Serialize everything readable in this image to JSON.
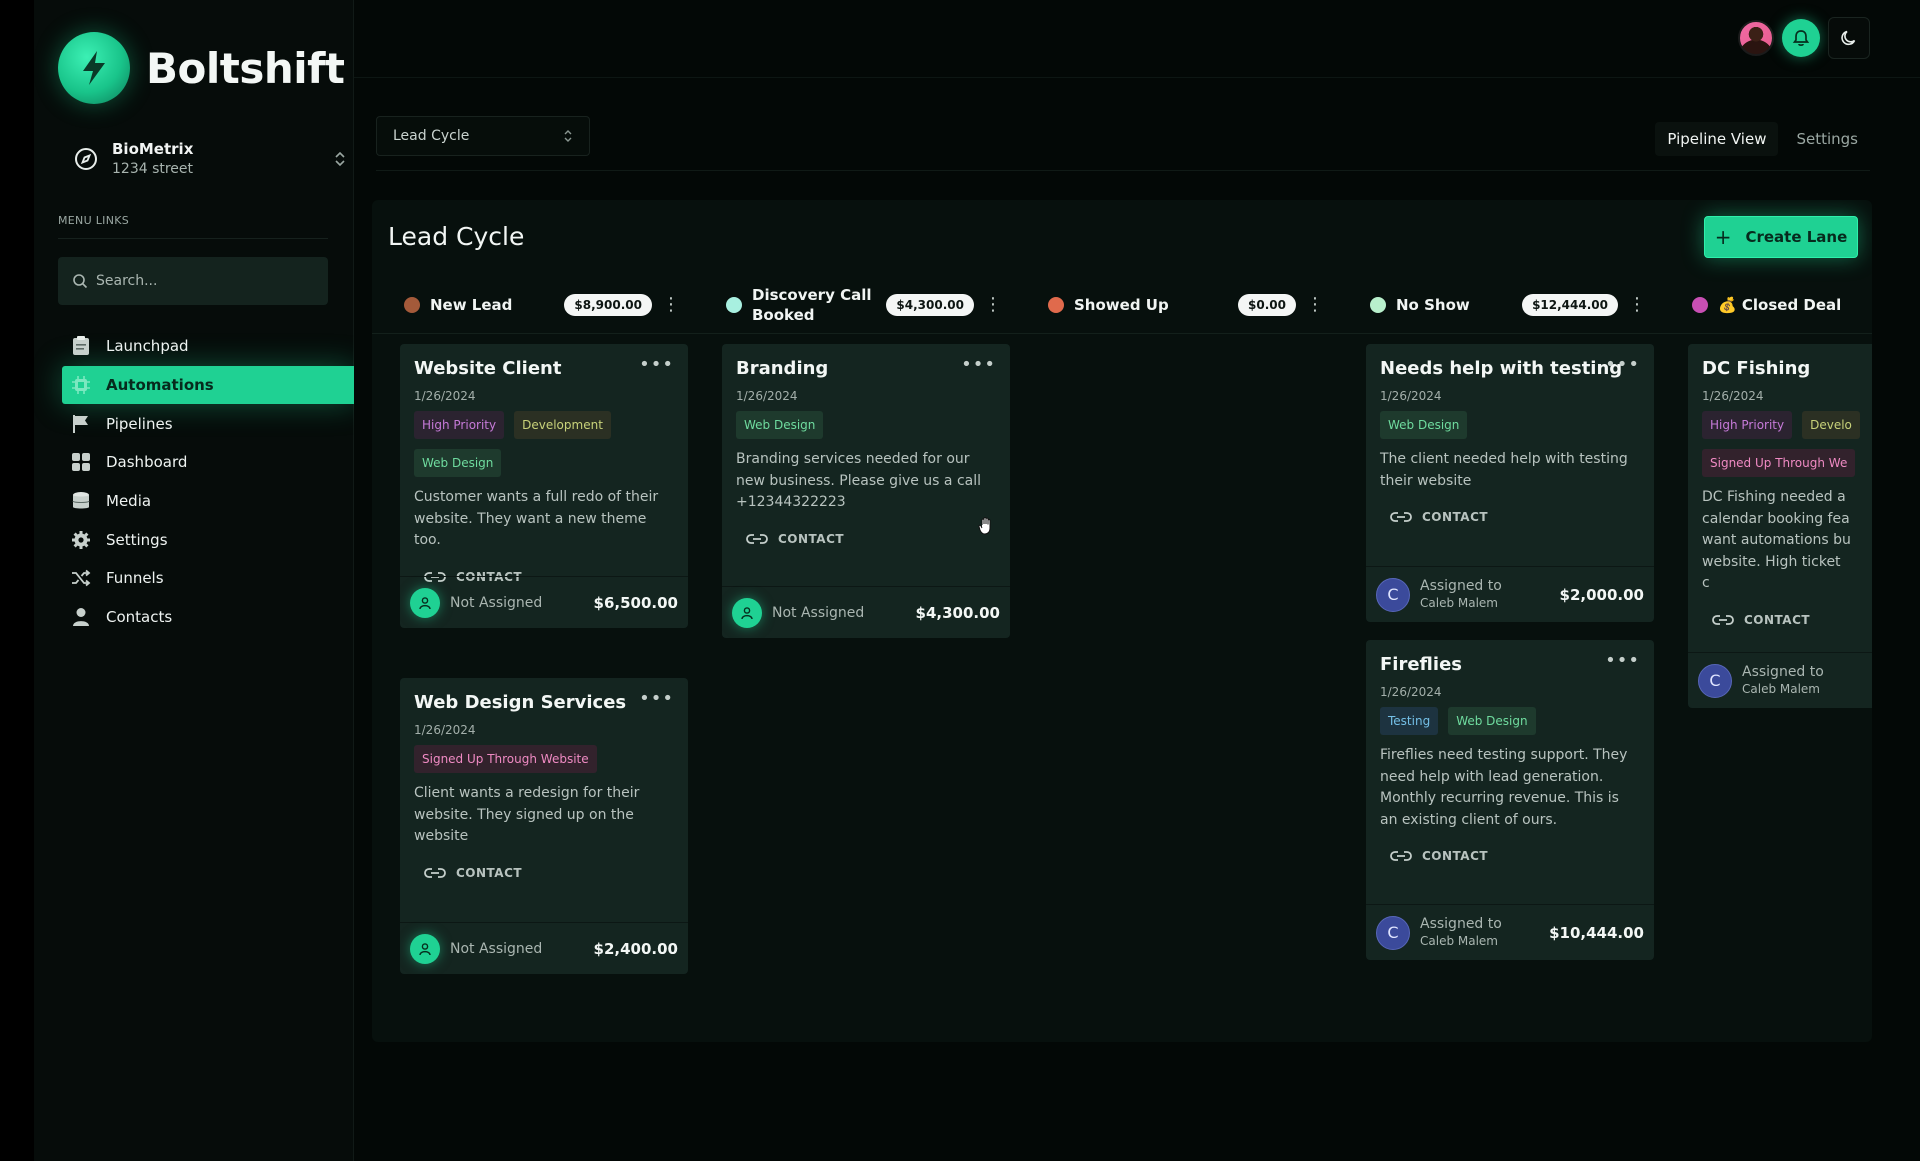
{
  "brand": {
    "name": "Boltshift"
  },
  "org": {
    "name": "BioMetrix",
    "address": "1234 street"
  },
  "sidebar": {
    "menu_label": "MENU LINKS",
    "search_placeholder": "Search...",
    "items": [
      {
        "label": "Launchpad",
        "icon": "clipboard-icon",
        "active": false
      },
      {
        "label": "Automations",
        "icon": "chip-icon",
        "active": true
      },
      {
        "label": "Pipelines",
        "icon": "flag-icon",
        "active": false
      },
      {
        "label": "Dashboard",
        "icon": "grid-icon",
        "active": false
      },
      {
        "label": "Media",
        "icon": "database-icon",
        "active": false
      },
      {
        "label": "Settings",
        "icon": "gear-icon",
        "active": false
      },
      {
        "label": "Funnels",
        "icon": "shuffle-icon",
        "active": false
      },
      {
        "label": "Contacts",
        "icon": "user-icon",
        "active": false
      }
    ]
  },
  "header": {
    "pipeline_select": "Lead Cycle",
    "tabs": [
      {
        "label": "Pipeline View",
        "active": true
      },
      {
        "label": "Settings",
        "active": false
      }
    ]
  },
  "board": {
    "title": "Lead Cycle",
    "create_label": "Create Lane",
    "lanes": [
      {
        "name": "New Lead",
        "total": "$8,900.00",
        "color": "#a45a3a"
      },
      {
        "name": "Discovery Call Booked",
        "total": "$4,300.00",
        "color": "#a8f0e0"
      },
      {
        "name": "Showed Up",
        "total": "$0.00",
        "color": "#e06a4c"
      },
      {
        "name": "No Show",
        "total": "$12,444.00",
        "color": "#b8f0cc"
      },
      {
        "name": "💰 Closed Deal",
        "total": "",
        "color": "#c84fb3"
      }
    ],
    "contact_label": "CONTACT",
    "cards": [
      {
        "title": "Website Client",
        "date": "1/26/2024",
        "tags": [
          "High Priority",
          "Development",
          "Web Design"
        ],
        "desc": "Customer wants a full redo of their website. They want a new theme too.",
        "assignee": "Not Assigned",
        "amount": "$6,500.00"
      },
      {
        "title": "Web Design Services",
        "date": "1/26/2024",
        "tags": [
          "Signed Up Through Website"
        ],
        "desc": "Client wants a redesign for their website. They signed up on the website",
        "assignee": "Not Assigned",
        "amount": "$2,400.00"
      },
      {
        "title": "Branding",
        "date": "1/26/2024",
        "tags": [
          "Web Design"
        ],
        "desc": "Branding services needed for our new business. Please give us a call +12344322223",
        "assignee": "Not Assigned",
        "amount": "$4,300.00"
      },
      {
        "title": "Needs help with testing",
        "date": "1/26/2024",
        "tags": [
          "Web Design"
        ],
        "desc": "The client needed help with testing their website",
        "assigned_label": "Assigned to",
        "assignee": "Caleb Malem",
        "initial": "C",
        "amount": "$2,000.00"
      },
      {
        "title": "Fireflies",
        "date": "1/26/2024",
        "tags": [
          "Testing",
          "Web Design"
        ],
        "desc": "Fireflies need testing support. They need help with lead generation. Monthly recurring revenue. This is an existing client of ours.",
        "assigned_label": "Assigned to",
        "assignee": "Caleb Malem",
        "initial": "C",
        "amount": "$10,444.00"
      },
      {
        "title": "DC Fishing",
        "date": "1/26/2024",
        "tags": [
          "High Priority",
          "Develo",
          "Signed Up Through We"
        ],
        "desc": "DC Fishing needed a calendar booking fea want automations bu website. High ticket c",
        "assigned_label": "Assigned to",
        "assignee": "Caleb Malem",
        "initial": "C"
      }
    ]
  },
  "colors": {
    "accent": "#1fd193",
    "background": "#030806",
    "card": "#142520"
  }
}
